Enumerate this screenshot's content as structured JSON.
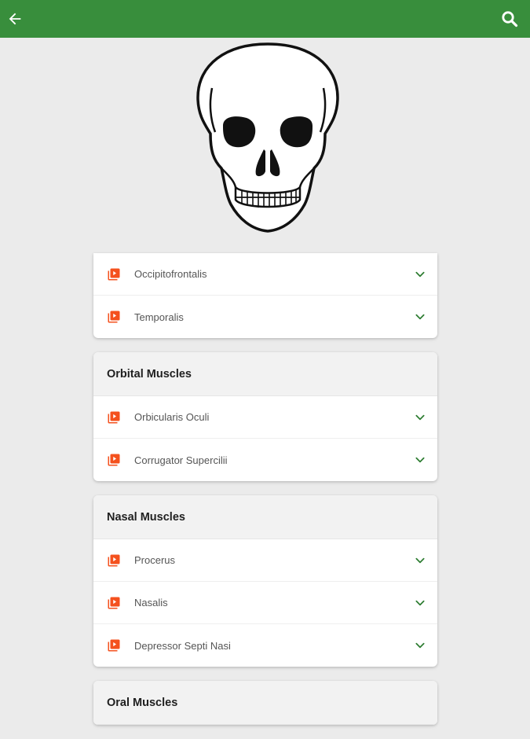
{
  "appbar": {
    "back_icon": "arrow-left-icon",
    "search_icon": "search-icon",
    "color": "#388e3c"
  },
  "illustration": "skull-icon",
  "sections": [
    {
      "title": "",
      "items": [
        {
          "label": "Occipitofrontalis"
        },
        {
          "label": "Temporalis"
        }
      ]
    },
    {
      "title": "Orbital Muscles",
      "items": [
        {
          "label": "Orbicularis Oculi"
        },
        {
          "label": "Corrugator Supercilii"
        }
      ]
    },
    {
      "title": "Nasal Muscles",
      "items": [
        {
          "label": "Procerus"
        },
        {
          "label": "Nasalis"
        },
        {
          "label": "Depressor Septi Nasi"
        }
      ]
    },
    {
      "title": "Oral Muscles",
      "items": []
    }
  ],
  "colors": {
    "accent": "#388e3c",
    "item_icon": "#f4511e",
    "chevron": "#2e7d32"
  }
}
